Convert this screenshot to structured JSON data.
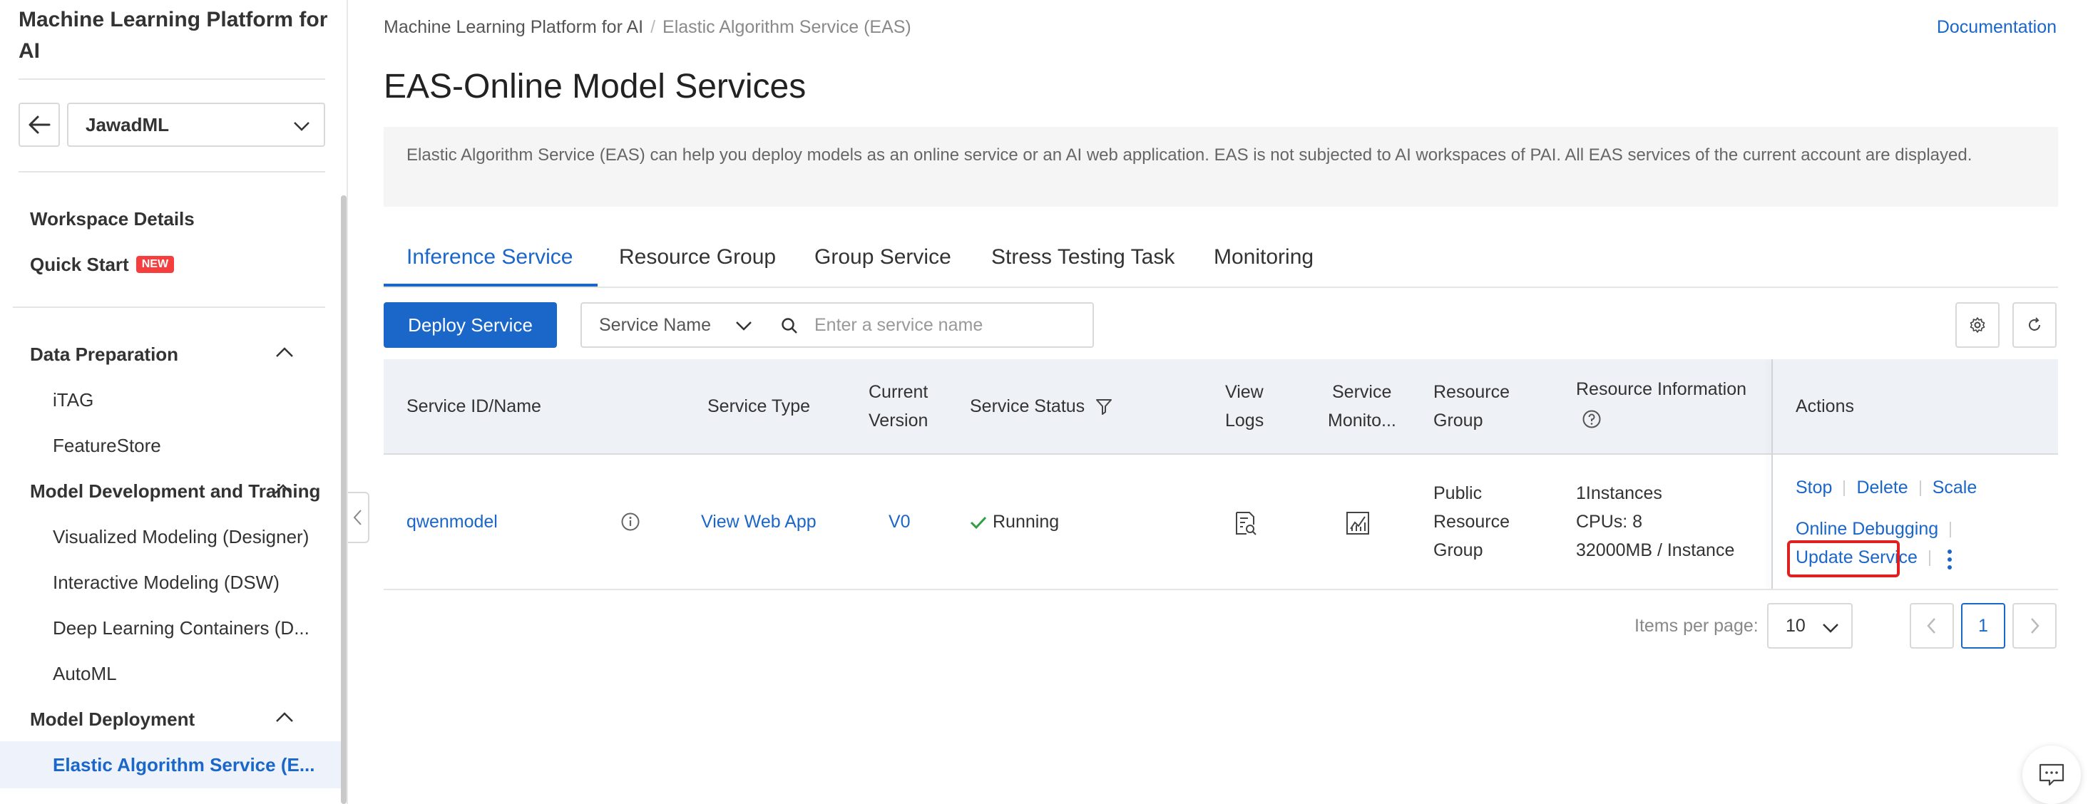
{
  "sidebar": {
    "title": "Machine Learning Platform for AI",
    "workspace": "JawadML",
    "workspace_details": "Workspace Details",
    "quick_start": "Quick Start",
    "new_badge": "NEW",
    "sections": {
      "data_preparation": "Data Preparation",
      "itag": "iTAG",
      "featurestore": "FeatureStore",
      "model_dev": "Model Development and Training",
      "designer": "Visualized Modeling (Designer)",
      "dsw": "Interactive Modeling (DSW)",
      "dlc": "Deep Learning Containers (D...",
      "automl": "AutoML",
      "model_deployment": "Model Deployment",
      "eas": "Elastic Algorithm Service (E..."
    }
  },
  "breadcrumb": {
    "root": "Machine Learning Platform for AI",
    "separator": "/",
    "current": "Elastic Algorithm Service (EAS)"
  },
  "documentation": "Documentation",
  "page_title": "EAS-Online Model Services",
  "info_text": "Elastic Algorithm Service (EAS) can help you deploy models as an online service or an AI web application. EAS is not subjected to AI workspaces of PAI. All EAS services of the current account are displayed.",
  "tabs": [
    "Inference Service",
    "Resource Group",
    "Group Service",
    "Stress Testing Task",
    "Monitoring"
  ],
  "toolbar": {
    "deploy": "Deploy Service",
    "filter_field": "Service Name",
    "search_placeholder": "Enter a service name"
  },
  "table": {
    "headers": {
      "id_name": "Service ID/Name",
      "type": "Service Type",
      "version_1": "Current",
      "version_2": "Version",
      "status": "Service Status",
      "logs_1": "View",
      "logs_2": "Logs",
      "monitor_1": "Service",
      "monitor_2": "Monito...",
      "group_1": "Resource",
      "group_2": "Group",
      "info": "Resource Information",
      "actions": "Actions"
    },
    "row": {
      "name": "qwenmodel",
      "type": "View Web App",
      "version": "V0",
      "status": "Running",
      "group_1": "Public",
      "group_2": "Resource",
      "group_3": "Group",
      "info_1": "1Instances",
      "info_2": "CPUs: 8",
      "info_3": "32000MB / Instance",
      "actions": {
        "stop": "Stop",
        "delete": "Delete",
        "scale": "Scale",
        "debug": "Online Debugging",
        "update": "Update Service"
      }
    }
  },
  "pagination": {
    "label": "Items per page:",
    "page_size": "10",
    "current_page": "1"
  },
  "colors": {
    "accent": "#1a66c9",
    "highlight_box": "#e02020",
    "running": "#2ea043",
    "new_badge": "#f53f3f"
  }
}
